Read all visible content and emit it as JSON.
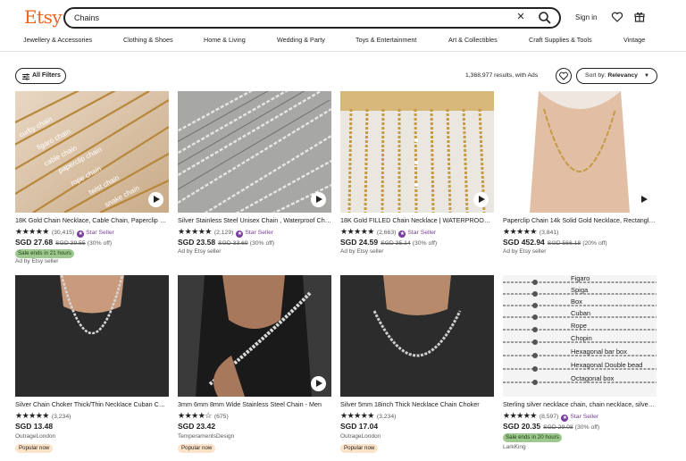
{
  "brand": {
    "logo": "Etsy",
    "color": "#f1641e"
  },
  "search": {
    "query": "Chains"
  },
  "header": {
    "sign_in": "Sign in",
    "icons": [
      "heart-icon",
      "gift-icon"
    ]
  },
  "categories": [
    "Jewellery & Accessories",
    "Clothing & Shoes",
    "Home & Living",
    "Wedding & Party",
    "Toys & Entertainment",
    "Art & Collectibles",
    "Craft Supplies & Tools",
    "Vintage"
  ],
  "toolbar": {
    "all_filters": "All Filters",
    "results": "1,368,977 results, with Ads",
    "sort_label": "Sort by:",
    "sort_value": "Relevancy"
  },
  "colors": {
    "star_seller": "#7a3f9e",
    "sale_badge": "#9ec98e",
    "popular_badge": "#fde3c7"
  },
  "listings": [
    {
      "title": "18K Gold Chain Necklace, Cable Chain, Paperclip Chain",
      "stars": "★★★★★",
      "reviews": "(30,415)",
      "star_seller": "Star Seller",
      "price": "SGD 27.68",
      "original_price": "SGD 39.55",
      "discount": "(30% off)",
      "badge": "Sale ends in 21 hours",
      "meta": "Ad by Etsy seller",
      "image_labels": [
        "curby chain",
        "figaro chain",
        "cable chain",
        "paperclip chain",
        "rope chain",
        "twist chain",
        "snake chain"
      ]
    },
    {
      "title": "Silver Stainless Steel Unisex Chain , Waterproof Chain",
      "stars": "★★★★★",
      "reviews": "(2,129)",
      "star_seller": "Star Seller",
      "price": "SGD 23.58",
      "original_price": "SGD 33.69",
      "discount": "(30% off)",
      "meta": "Ad by Etsy seller"
    },
    {
      "title": "18K Gold FILLED Chain Necklace | WATERPROOF Chain",
      "stars": "★★★★★",
      "reviews": "(2,663)",
      "star_seller": "Star Seller",
      "price": "SGD 24.59",
      "original_price": "SGD 35.14",
      "discount": "(30% off)",
      "meta": "Ad by Etsy seller"
    },
    {
      "title": "Paperclip Chain 14k Solid Gold Necklace, Rectangle Chain",
      "stars": "★★★★★",
      "reviews": "(3,841)",
      "price": "SGD 452.94",
      "original_price": "SGD 566.18",
      "discount": "(20% off)",
      "meta": "Ad by Etsy seller"
    },
    {
      "title": "Silver Chain Choker Thick/Thin Necklace Cuban Chain",
      "stars": "★★★★★",
      "reviews": "(3,234)",
      "price": "SGD 13.48",
      "meta": "OutrageLondon",
      "badge": "Popular now"
    },
    {
      "title": "3mm 6mm 8mm Wide Stainless Steel Chain - Men",
      "stars": "★★★★☆",
      "reviews": "(675)",
      "price": "SGD 23.42",
      "meta": "TemperamentsDesign",
      "badge": "Popular now"
    },
    {
      "title": "Silver 5mm 18inch Thick Necklace Chain Choker",
      "stars": "★★★★★",
      "reviews": "(3,234)",
      "price": "SGD 17.04",
      "meta": "OutrageLondon",
      "badge": "Popular now"
    },
    {
      "title": "Sterling silver necklace chain, chain necklace, silver chain",
      "stars": "★★★★★",
      "reviews": "(8,597)",
      "star_seller": "Star Seller",
      "price": "SGD 20.35",
      "original_price": "SGD 29.08",
      "discount": "(30% off)",
      "badge": "Sale ends in 20 hours",
      "meta": "LarkKing",
      "image_labels": [
        "Figaro",
        "Spiga",
        "Box",
        "Cuban",
        "Rope",
        "Chopin",
        "Hexagonal bar box",
        "Hexagonal Double bead",
        "Octagonal box"
      ]
    }
  ]
}
